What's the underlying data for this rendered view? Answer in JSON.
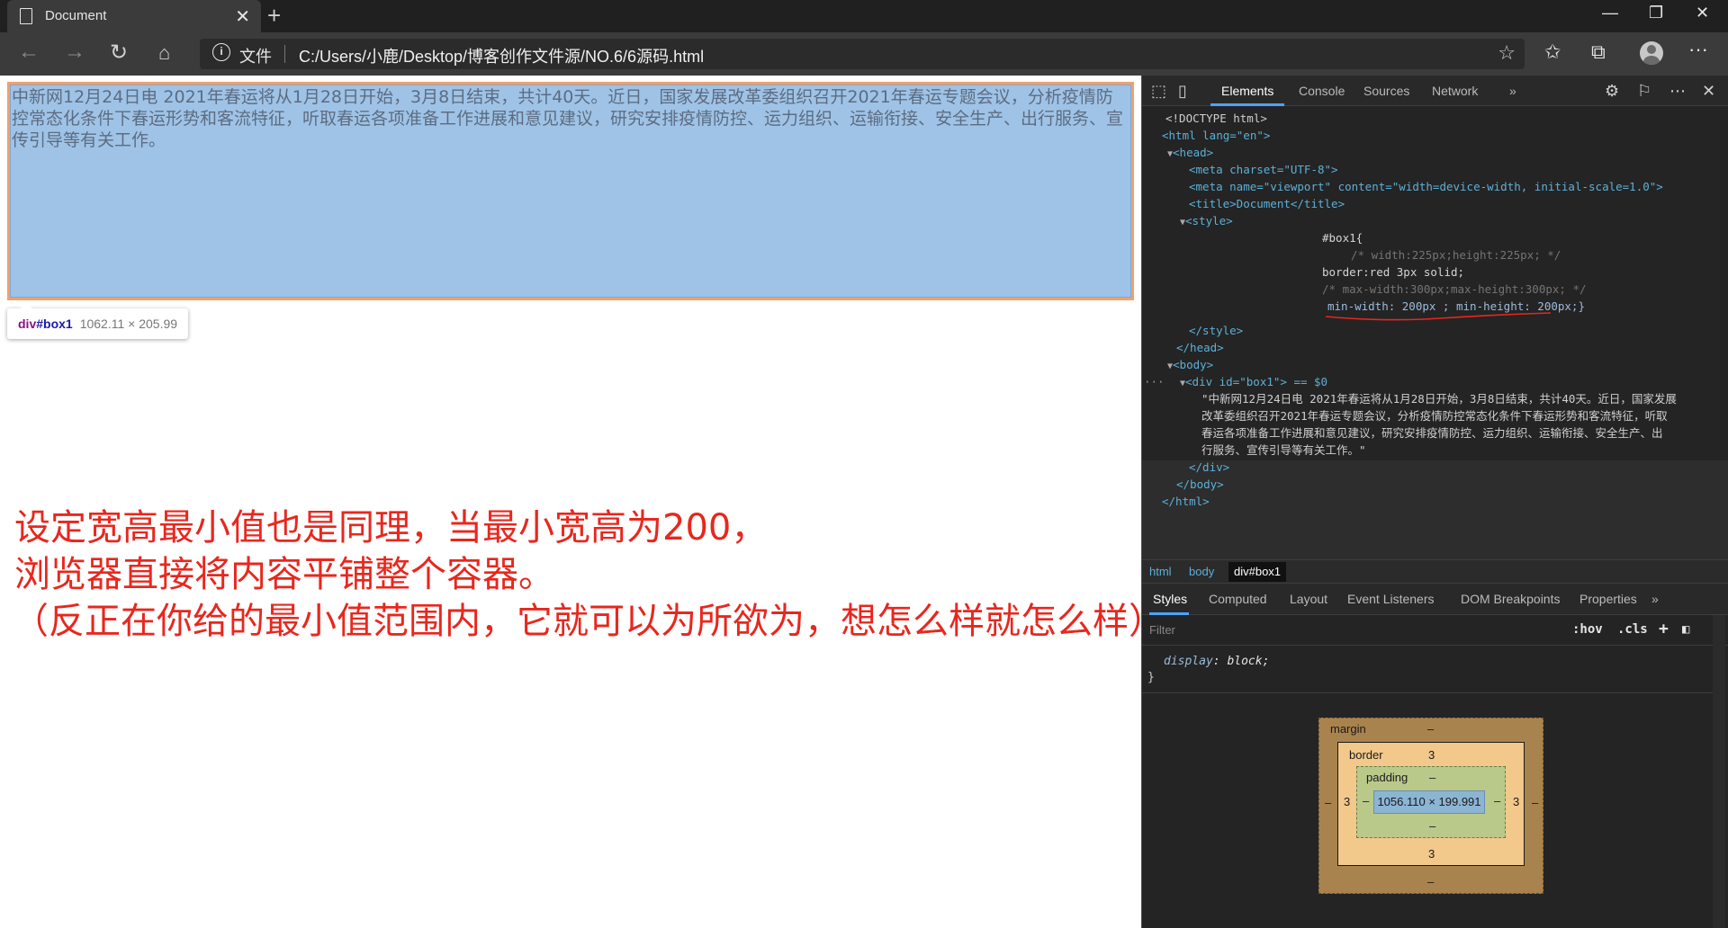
{
  "browser": {
    "tab_title": "Document",
    "new_tab": "+",
    "address_site_label": "文件",
    "url": "C:/Users/小鹿/Desktop/博客创作文件源/NO.6/6源码.html"
  },
  "page": {
    "box_text": "中新网12月24日电 2021年春运将从1月28日开始，3月8日结束，共计40天。近日，国家发展改革委组织召开2021年春运专题会议，分析疫情防控常态化条件下春运形势和客流特征，听取春运各项准备工作进展和意见建议，研究安排疫情防控、运力组织、运输衔接、安全生产、出行服务、宣传引导等有关工作。",
    "tooltip": {
      "tag": "div",
      "id": "#box1",
      "dims": "1062.11 × 205.99"
    },
    "annotation": [
      "设定宽高最小值也是同理，当最小宽高为200，",
      "浏览器直接将内容平铺整个容器。",
      "（反正在你给的最小值范围内，它就可以为所欲为，想怎么样就怎么样）"
    ]
  },
  "devtools": {
    "tabs": [
      "Elements",
      "Console",
      "Sources",
      "Network"
    ],
    "active_tab": "Elements",
    "dom": {
      "doctype": "<!DOCTYPE html>",
      "html_open": "<html lang=\"en\">",
      "head_open": "<head>",
      "meta_charset": "<meta charset=\"UTF-8\">",
      "meta_viewport": "<meta name=\"viewport\" content=\"width=device-width, initial-scale=1.0\">",
      "title": "<title>Document</title>",
      "style_open": "<style>",
      "css1": "#box1{",
      "css2": "/* width:225px;height:225px; */",
      "css3": "border:red 3px solid;",
      "css4": "/* max-width:300px;max-height:300px; */",
      "css5": "min-width: 200px ; min-height: 200px;}",
      "style_close": "</style>",
      "head_close": "</head>",
      "body_open": "<body>",
      "div_open": "<div id=\"box1\"> == $0",
      "div_text": [
        "\"中新网12月24日电 2021年春运将从1月28日开始，3月8日结束，共计40天。近日，国家发展",
        "改革委组织召开2021年春运专题会议，分析疫情防控常态化条件下春运形势和客流特征，听取",
        "春运各项准备工作进展和意见建议，研究安排疫情防控、运力组织、运输衔接、安全生产、出",
        "行服务、宣传引导等有关工作。\""
      ],
      "div_close": "</div>",
      "body_close": "</body>",
      "html_close": "</html>"
    },
    "breadcrumbs": [
      "html",
      "body",
      "div#box1"
    ],
    "subtabs": [
      "Styles",
      "Computed",
      "Layout",
      "Event Listeners",
      "DOM Breakpoints",
      "Properties"
    ],
    "filter_placeholder": "Filter",
    "hov": ":hov",
    "cls": ".cls",
    "style_rule": {
      "prop": "display",
      "value": "block;",
      "close": "}"
    },
    "box_model": {
      "margin_label": "margin",
      "margin_top": "–",
      "margin_bottom": "–",
      "margin_left": "–",
      "margin_right": "–",
      "border_label": "border",
      "border_top": "3",
      "border_bottom": "3",
      "border_left": "3",
      "border_right": "3",
      "padding_label": "padding",
      "padding_top": "–",
      "padding_bottom": "–",
      "padding_left": "–",
      "padding_right": "–",
      "content": "1056.110 × 199.991"
    }
  }
}
